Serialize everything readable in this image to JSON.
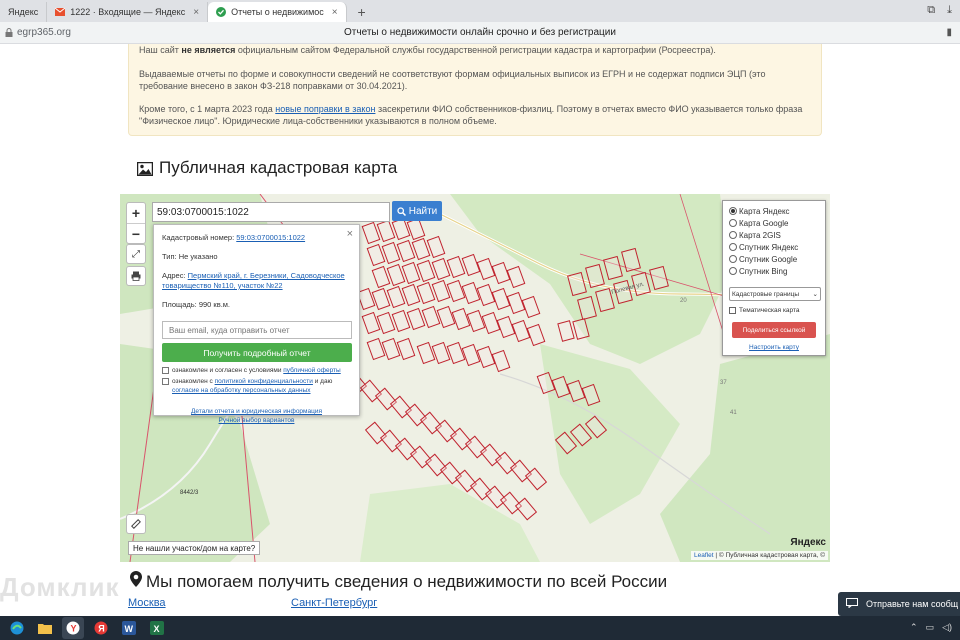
{
  "browser": {
    "tabs": [
      {
        "label": "Яндекс",
        "active": false
      },
      {
        "label": "1222 · Входящие — Яндекс",
        "active": false
      },
      {
        "label": "Отчеты о недвижимос",
        "active": true
      }
    ],
    "url": "egrp365.org",
    "page_title": "Отчеты о недвижимости онлайн срочно и без регистрации"
  },
  "notice": {
    "p1_before": "Наш сайт ",
    "p1_bold": "не является",
    "p1_after": " официальным сайтом Федеральной службы государственной регистрации кадастра и картографии (Росреестра).",
    "p2": "Выдаваемые отчеты по форме и совокупности сведений не соответствуют формам официальных выписок из ЕГРН и не содержат подписи ЭЦП (это требование внесено в закон ФЗ-218 поправками от 30.04.2021).",
    "p3_before": "Кроме того, с 1 марта 2023 года ",
    "p3_link": "новые поправки в закон",
    "p3_after": " засекретили ФИО собственников-физлиц. Поэтому в отчетах вместо ФИО указывается только фраза \"Физическое лицо\". Юридические лица-собственники указываются в полном объеме."
  },
  "section_title": "Публичная кадастровая карта",
  "map": {
    "search_value": "59:03:0700015:1022",
    "find_button": "Найти",
    "zoom_in": "+",
    "zoom_out": "−",
    "popup": {
      "cad_label": "Кадастровый номер:",
      "cad_value": "59:03:0700015:1022",
      "type_label": "Тип:",
      "type_value": "Не указано",
      "address_label": "Адрес:",
      "address_value": "Пермский край, г. Березники, Садоводческое товарищество №110, участок №22",
      "area_label": "Площадь:",
      "area_value": "990 кв.м.",
      "email_placeholder": "Ваш email, куда отправить отчет",
      "get_report_button": "Получить подробный отчет",
      "agree1_text": "ознакомлен и согласен с условиями ",
      "agree1_link": "публичной оферты",
      "agree2_text": "ознакомлен с ",
      "agree2_link": "политикой конфиденциальности",
      "agree2_mid": " и даю ",
      "agree2_link2": "согласие на обработку персональных данных",
      "details_link": "Детали отчета и юридическая информация",
      "manual_link": "Ручной выбор вариантов"
    },
    "layers": {
      "options": [
        "Карта Яндекс",
        "Карта Google",
        "Карта 2GIS",
        "Спутник Яндекс",
        "Спутник Google",
        "Спутник Bing"
      ],
      "selected": 0,
      "select_value": "Кадастровые границы",
      "thematic_label": "Тематическая карта",
      "share_button": "Поделиться ссылкой",
      "setup_link": "Настроить карту"
    },
    "not_found_button": "Не нашли участок/дом на карте?",
    "attribution_leaflet": "Leaflet",
    "attribution_text": " | © Публичная кадастровая карта, ©",
    "yandex_logo": "Яндекс",
    "label_8442": "8442/3"
  },
  "help_title": "Мы помогаем получить сведения о недвижимости по всей России",
  "cities": [
    "Москва",
    "Санкт-Петербург"
  ],
  "watermark": "Домклик",
  "chat_widget": "Отправьте нам сообщ",
  "colors": {
    "accent_blue": "#3a7fd0",
    "green_button": "#4cae4c",
    "red_button": "#d9534f",
    "notice_bg": "#fdf6e3",
    "parcel_red": "#c0242f"
  }
}
